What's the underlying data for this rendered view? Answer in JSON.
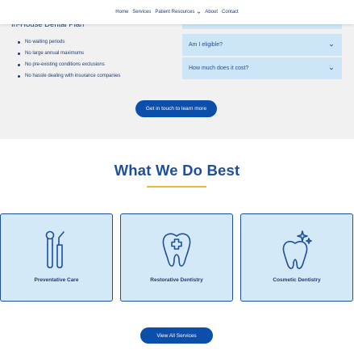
{
  "nav": {
    "items": [
      "Home",
      "Services",
      "Patient Resources",
      "About",
      "Contact"
    ]
  },
  "plan": {
    "title": "In-House Dental Plan",
    "bullets": [
      "No waiting periods",
      "No large annual maximums",
      "No pre-existing conditions exclusions",
      "No hassle dealing with insurance companies"
    ]
  },
  "faq": {
    "items": [
      "Am I eligible?",
      "How much does it cost?"
    ]
  },
  "cta": {
    "contact_label": "Get in touch to learn more",
    "services_label": "View All Services"
  },
  "services": {
    "heading": "What We Do Best",
    "cards": [
      {
        "label": "Preventative Care",
        "icon": "dental-tools-icon"
      },
      {
        "label": "Restorative Dentistry",
        "icon": "tooth-cross-icon"
      },
      {
        "label": "Cosmetic Dentistry",
        "icon": "sparkling-tooth-icon"
      }
    ]
  },
  "colors": {
    "brand_blue": "#0b4fab",
    "heading_blue": "#1d4f9c",
    "accent_gold": "#e8b93a",
    "card_bg": "#d3e9f8",
    "accordion_bg": "#cce6f7"
  }
}
